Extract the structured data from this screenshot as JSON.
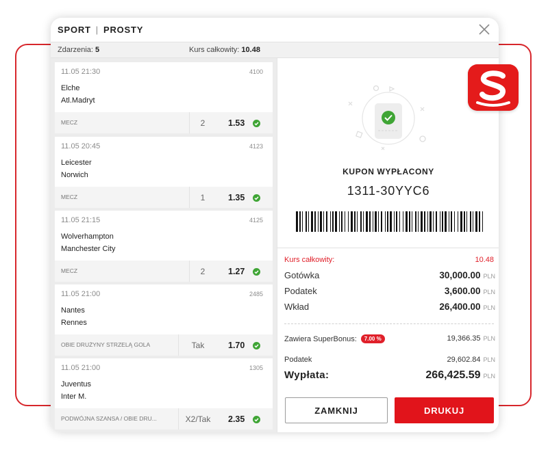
{
  "header": {
    "tab_sport": "SPORT",
    "separator": "|",
    "tab_simple": "PROSTY"
  },
  "summary": {
    "events_label": "Zdarzenia:",
    "events_value": "5",
    "odds_label": "Kurs całkowity:",
    "odds_value": "10.48"
  },
  "bets": [
    {
      "date": "11.05  21:30",
      "code": "4100",
      "team1": "Elche",
      "team2": "Atl.Madryt",
      "market": "MECZ",
      "pick": "2",
      "odds": "1.53"
    },
    {
      "date": "11.05  20:45",
      "code": "4123",
      "team1": "Leicester",
      "team2": "Norwich",
      "market": "MECZ",
      "pick": "1",
      "odds": "1.35"
    },
    {
      "date": "11.05  21:15",
      "code": "4125",
      "team1": "Wolverhampton",
      "team2": "Manchester City",
      "market": "MECZ",
      "pick": "2",
      "odds": "1.27"
    },
    {
      "date": "11.05  21:00",
      "code": "2485",
      "team1": "Nantes",
      "team2": "Rennes",
      "market": "OBIE DRUŻYNY STRZELĄ GOLA",
      "pick": "Tak",
      "odds": "1.70"
    },
    {
      "date": "11.05  21:00",
      "code": "1305",
      "team1": "Juventus",
      "team2": "Inter M.",
      "market": "PODWÓJNA SZANSA / OBIE DRU...",
      "pick": "X2/Tak",
      "odds": "2.35"
    }
  ],
  "coupon": {
    "status": "KUPON WYPŁACONY",
    "id": "1311-30YYC6",
    "total_odds_label": "Kurs całkowity:",
    "total_odds_value": "10.48",
    "currency": "PLN",
    "cash_label": "Gotówka",
    "cash_value": "30,000.00",
    "tax_label": "Podatek",
    "tax_value": "3,600.00",
    "stake_label": "Wkład",
    "stake_value": "26,400.00",
    "superbonus_label": "Zawiera SuperBonus:",
    "superbonus_percent": "7.00 %",
    "superbonus_value": "19,366.35",
    "tax2_label": "Podatek",
    "tax2_value": "29,602.84",
    "payout_label": "Wypłata:",
    "payout_value": "266,425.59"
  },
  "buttons": {
    "close": "ZAMKNIJ",
    "print": "DRUKUJ"
  },
  "colors": {
    "brand_red": "#e1141b",
    "success_green": "#3fa535"
  },
  "icons": [
    "close-icon",
    "check-icon",
    "brand-s-logo"
  ]
}
